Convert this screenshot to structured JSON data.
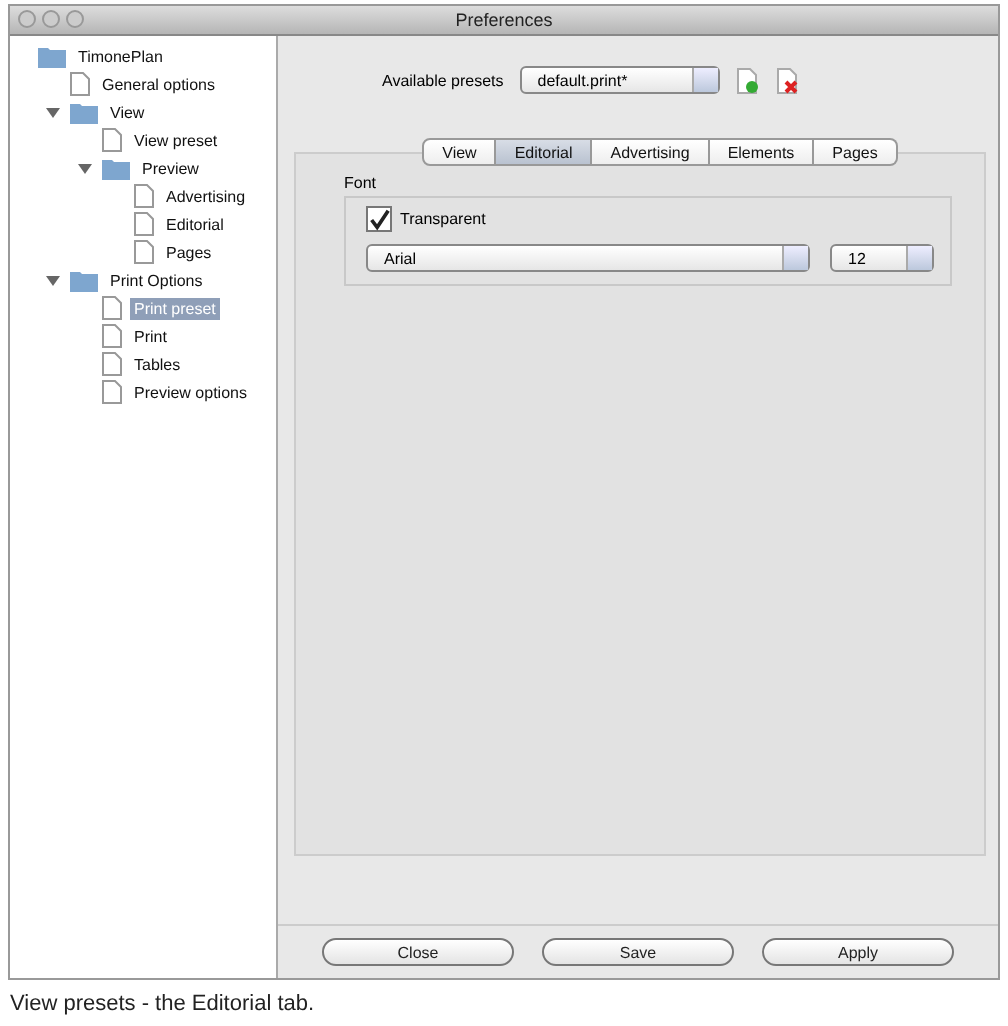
{
  "window": {
    "title": "Preferences"
  },
  "sidebar": {
    "items": [
      {
        "label": "TimonePlan",
        "kind": "folder",
        "selected": false,
        "children": [
          {
            "label": "General options",
            "kind": "doc",
            "selected": false
          },
          {
            "label": "View",
            "kind": "folder",
            "selected": false,
            "expanded": true,
            "children": [
              {
                "label": "View preset",
                "kind": "doc",
                "selected": false
              },
              {
                "label": "Preview",
                "kind": "folder",
                "selected": false,
                "expanded": true,
                "children": [
                  {
                    "label": "Advertising",
                    "kind": "doc",
                    "selected": false
                  },
                  {
                    "label": "Editorial",
                    "kind": "doc",
                    "selected": false
                  },
                  {
                    "label": "Pages",
                    "kind": "doc",
                    "selected": false
                  }
                ]
              }
            ]
          },
          {
            "label": "Print Options",
            "kind": "folder",
            "selected": false,
            "expanded": true,
            "children": [
              {
                "label": "Print preset",
                "kind": "doc",
                "selected": true
              },
              {
                "label": "Print",
                "kind": "doc",
                "selected": false
              },
              {
                "label": "Tables",
                "kind": "doc",
                "selected": false
              },
              {
                "label": "Preview options",
                "kind": "doc",
                "selected": false
              }
            ]
          }
        ]
      }
    ]
  },
  "presets": {
    "label": "Available presets",
    "value": "default.print*"
  },
  "tabs": [
    {
      "label": "View",
      "selected": false
    },
    {
      "label": "Editorial",
      "selected": true
    },
    {
      "label": "Advertising",
      "selected": false
    },
    {
      "label": "Elements",
      "selected": false
    },
    {
      "label": "Pages",
      "selected": false
    }
  ],
  "font_group": {
    "title": "Font",
    "transparent": {
      "label": "Transparent",
      "checked": true
    },
    "family": "Arial",
    "size": "12"
  },
  "buttons": [
    "Close",
    "Save",
    "Apply"
  ],
  "caption": "View presets - the Editorial tab."
}
